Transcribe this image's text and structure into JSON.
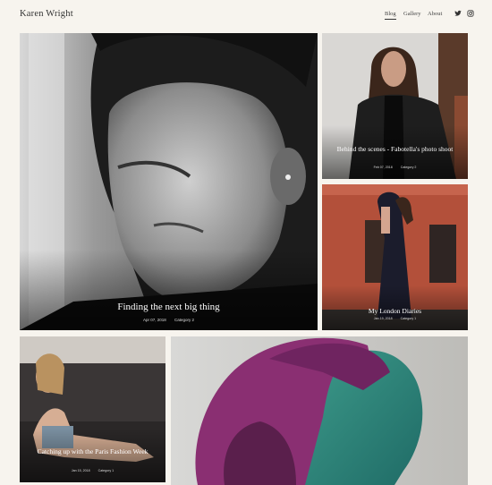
{
  "site": {
    "title": "Karen Wright"
  },
  "nav": {
    "items": [
      "Blog",
      "Gallery",
      "About"
    ],
    "active": "Blog"
  },
  "social": {
    "icons": [
      "twitter-icon",
      "instagram-icon"
    ]
  },
  "posts": [
    {
      "title": "Finding the next big thing",
      "date": "Apr 07, 2018",
      "category": "Category 2"
    },
    {
      "title": "Behind the scenes - Fabotella's photo shoot",
      "date": "Feb 07, 2018",
      "category": "Category 2"
    },
    {
      "title": "My London Diaries",
      "date": "Jan 19, 2018",
      "category": "Category 1"
    },
    {
      "title": "Catching up with the Paris Fashion Week",
      "date": "Jan 15, 2018",
      "category": "Category 1"
    },
    {
      "title": "",
      "date": "",
      "category": ""
    }
  ],
  "colors": {
    "background": "#f7f4ee",
    "text": "#333333",
    "overlay_text": "#ffffff"
  }
}
